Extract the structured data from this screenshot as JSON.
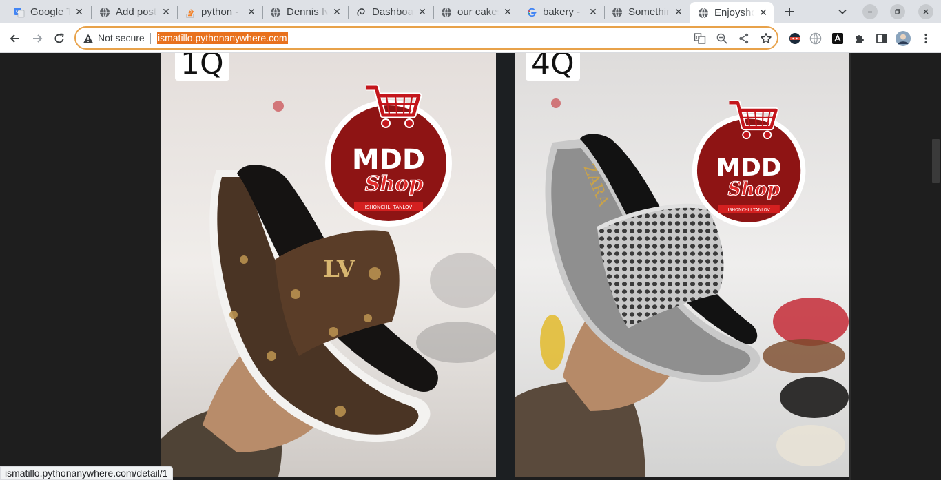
{
  "browser": {
    "tabs": [
      {
        "title": "Google Translate",
        "icon": "google-translate-icon",
        "active": false
      },
      {
        "title": "Add post",
        "icon": "globe-icon",
        "active": false
      },
      {
        "title": "python - ",
        "icon": "stackoverflow-icon",
        "active": false
      },
      {
        "title": "Dennis Ivy",
        "icon": "globe-icon",
        "active": false
      },
      {
        "title": "Dashboard",
        "icon": "pythonanywhere-icon",
        "active": false
      },
      {
        "title": "our cakes",
        "icon": "globe-icon",
        "active": false
      },
      {
        "title": "bakery - ",
        "icon": "google-icon",
        "active": false
      },
      {
        "title": "Something",
        "icon": "globe-icon",
        "active": false
      },
      {
        "title": "Enjoyshop",
        "icon": "globe-icon",
        "active": true
      }
    ],
    "security_label": "Not secure",
    "url": "ismatillo.pythonanywhere.com",
    "status_url": "ismatillo.pythonanywhere.com/detail/1",
    "colors": {
      "accent_orange": "#e8711d",
      "omnibox_border": "#e8a24a"
    }
  },
  "products": [
    {
      "code": "1Q",
      "brand_logo": "MDD Shop",
      "logo_tagline": "ISHONCHLI TANLOV",
      "description": "brown monogram platform slide sandal"
    },
    {
      "code": "4Q",
      "brand_logo": "MDD Shop",
      "logo_tagline": "ISHONCHLI TANLOV",
      "description": "silver mesh platform slide sandal"
    }
  ]
}
